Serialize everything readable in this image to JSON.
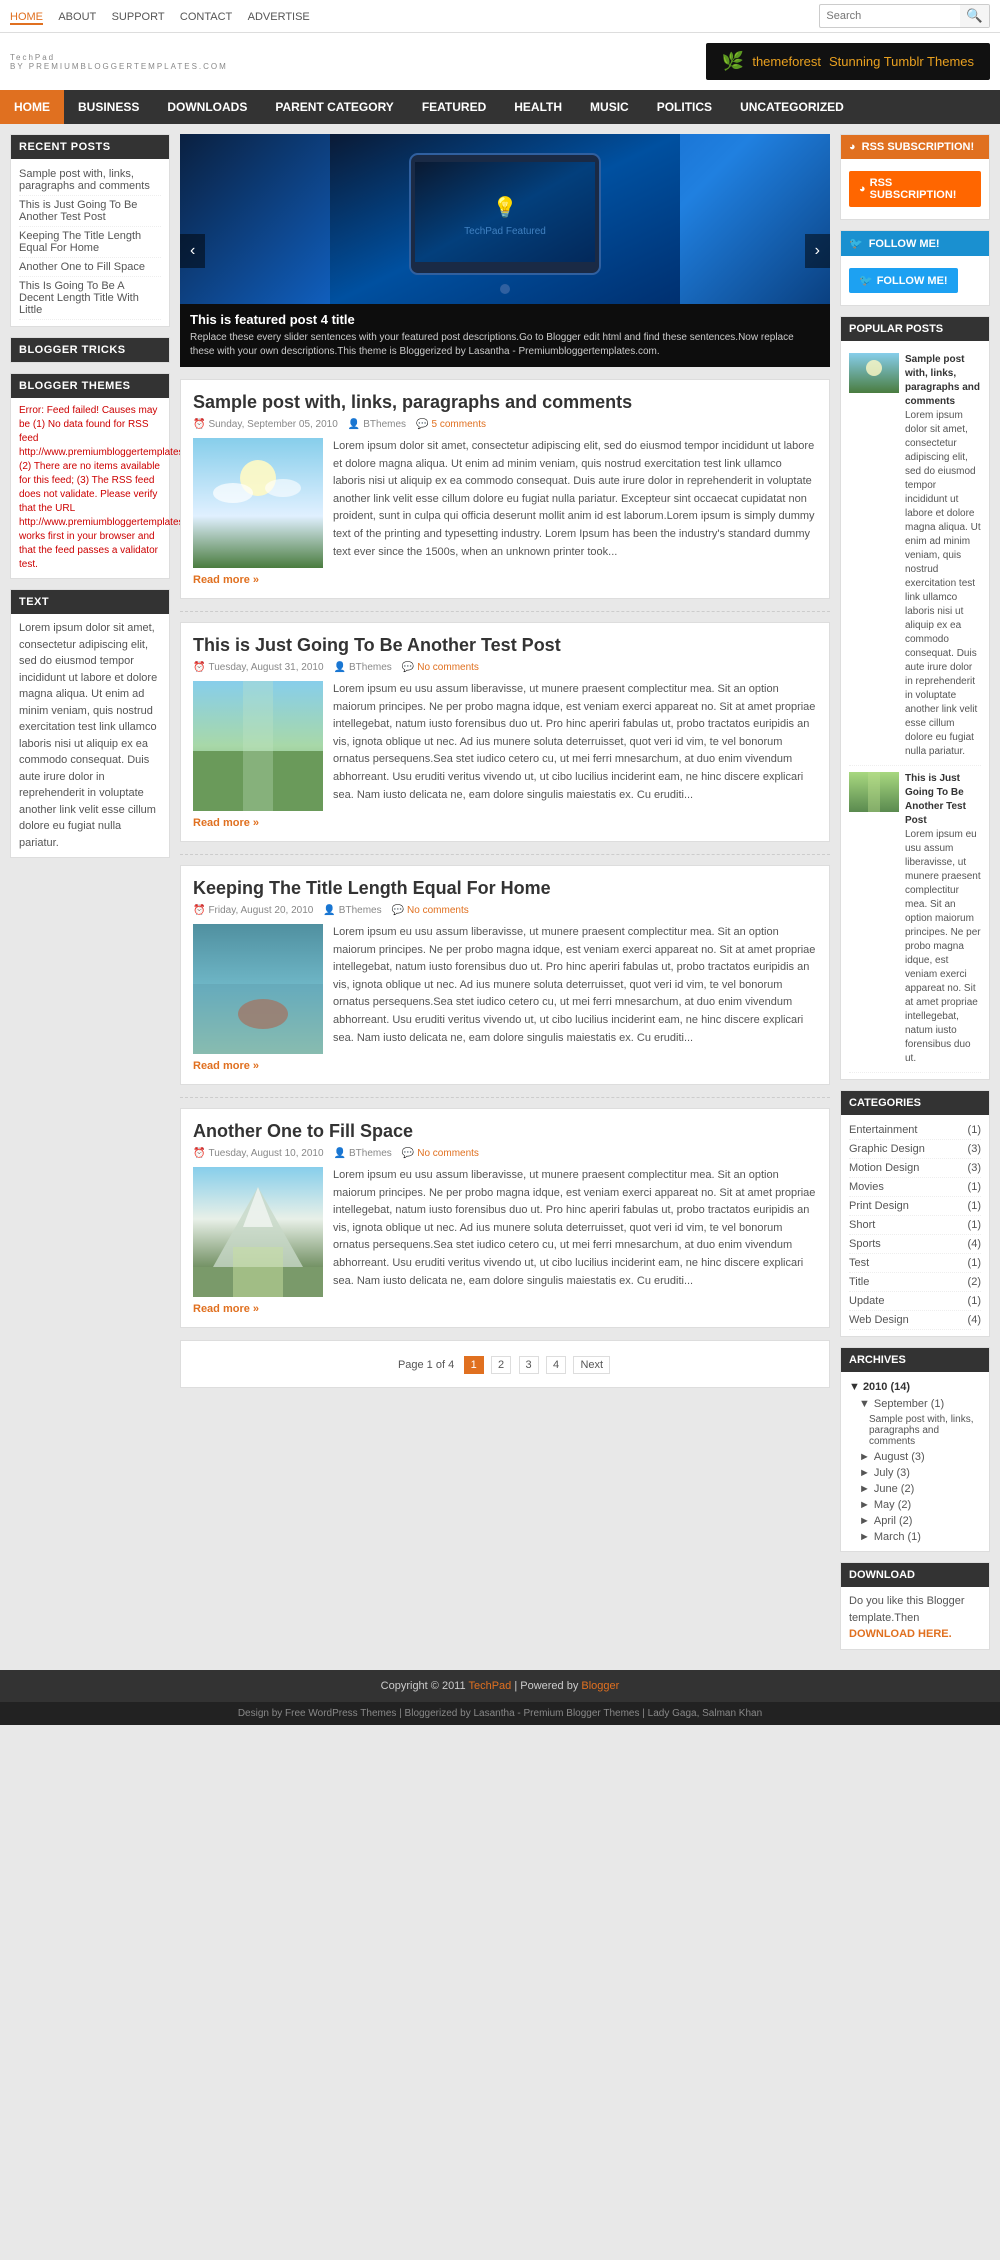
{
  "topnav": {
    "links": [
      {
        "label": "HOME",
        "active": true
      },
      {
        "label": "ABOUT",
        "active": false
      },
      {
        "label": "SUPPORT",
        "active": false
      },
      {
        "label": "CONTACT",
        "active": false
      },
      {
        "label": "ADVERTISE",
        "active": false
      }
    ],
    "search_placeholder": "Search"
  },
  "header": {
    "logo": "TechPad",
    "tagline": "BY PREMIUMBLOGGERTEMPLATES.COM",
    "banner_text": "Stunning Tumblr Themes",
    "banner_site": "themeforest"
  },
  "mainnav": {
    "links": [
      {
        "label": "HOME",
        "active": true
      },
      {
        "label": "BUSINESS",
        "active": false
      },
      {
        "label": "DOWNLOADS",
        "active": false
      },
      {
        "label": "PARENT CATEGORY",
        "active": false
      },
      {
        "label": "FEATURED",
        "active": false
      },
      {
        "label": "HEALTH",
        "active": false
      },
      {
        "label": "MUSIC",
        "active": false
      },
      {
        "label": "POLITICS",
        "active": false
      },
      {
        "label": "UNCATEGORIZED",
        "active": false
      }
    ]
  },
  "left_sidebar": {
    "recent_posts_title": "RECENT POSTS",
    "recent_posts": [
      {
        "title": "Sample post with, links, paragraphs and comments"
      },
      {
        "title": "This is Just Going To Be Another Test Post"
      },
      {
        "title": "Keeping The Title Length Equal For Home"
      },
      {
        "title": "Another One to Fill Space"
      },
      {
        "title": "This Is Going To Be A Decent Length Title With Little"
      }
    ],
    "blogger_tricks_title": "BLOGGER TRICKS",
    "blogger_themes_title": "BLOGGER THEMES",
    "blogger_themes_error": "Error: Feed failed! Causes may be (1) No data found for RSS feed http://www.premiumbloggertemplates.com/feed; (2) There are no items available for this feed; (3) The RSS feed does not validate.\n\nPlease verify that the URL http://www.premiumbloggertemplates.com/feed works first in your browser and that the feed passes a validator test.",
    "text_title": "TEXT",
    "text_content": "Lorem ipsum dolor sit amet, consectetur adipiscing elit, sed do eiusmod tempor incididunt ut labore et dolore magna aliqua. Ut enim ad minim veniam, quis nostrud exercitation test link ullamco laboris nisi ut aliquip ex ea commodo consequat. Duis aute irure dolor in reprehenderit in voluptate another link velit esse cillum dolore eu fugiat nulla pariatur."
  },
  "slider": {
    "featured_title": "This is featured post 4 title",
    "featured_desc": "Replace these every slider sentences with your featured post descriptions.Go to Blogger edit html and find these sentences.Now replace these with your own descriptions.This theme is Bloggerized by Lasantha - Premiumbloggertemplates.com."
  },
  "posts": [
    {
      "id": 1,
      "title": "Sample post with, links, paragraphs and comments",
      "date": "Sunday, September 05, 2010",
      "author": "BThemes",
      "comments": "5 comments",
      "thumb_class": "post-thumb-sky",
      "excerpt": "Lorem ipsum dolor sit amet, consectetur adipiscing elit, sed do eiusmod tempor incididunt ut labore et dolore magna aliqua. Ut enim ad minim veniam, quis nostrud exercitation test link ullamco laboris nisi ut aliquip ex ea commodo consequat. Duis aute irure dolor in reprehenderit in voluptate another link velit esse cillum dolore eu fugiat nulla pariatur. Excepteur sint occaecat cupidatat non proident, sunt in culpa qui officia deserunt mollit anim id est laborum.Lorem ipsum is simply dummy text of the printing and typesetting industry. Lorem Ipsum has been the industry's standard dummy text ever since the 1500s, when an unknown printer took...",
      "read_more": "Read more »"
    },
    {
      "id": 2,
      "title": "This is Just Going To Be Another Test Post",
      "date": "Tuesday, August 31, 2010",
      "author": "BThemes",
      "comments": "No comments",
      "thumb_class": "post-thumb-field",
      "excerpt": "Lorem ipsum eu usu assum liberavisse, ut munere praesent complectitur mea. Sit an option maiorum principes. Ne per probo magna idque, est veniam exerci appareat no. Sit at amet propriae intellegebat, natum iusto forensibus duo ut. Pro hinc aperiri fabulas ut, probo tractatos euripidis an vis, ignota oblique ut nec. Ad ius munere soluta deterruisset, quot veri id vim, te vel bonorum ornatus persequens.Sea stet iudico cetero cu, ut mei ferri mnesarchum, at duo enim vivendum abhorreant. Usu eruditi veritus vivendo ut, ut cibo lucilius inciderint eam, ne hinc discere explicari sea. Nam iusto delicata ne, eam dolore singulis maiestatis ex. Cu eruditi...",
      "read_more": "Read more »"
    },
    {
      "id": 3,
      "title": "Keeping The Title Length Equal For Home",
      "date": "Friday, August 20, 2010",
      "author": "BThemes",
      "comments": "No comments",
      "thumb_class": "post-thumb-water",
      "excerpt": "Lorem ipsum eu usu assum liberavisse, ut munere praesent complectitur mea. Sit an option maiorum principes. Ne per probo magna idque, est veniam exerci appareat no. Sit at amet propriae intellegebat, natum iusto forensibus duo ut. Pro hinc aperiri fabulas ut, probo tractatos euripidis an vis, ignota oblique ut nec. Ad ius munere soluta deterruisset, quot veri id vim, te vel bonorum ornatus persequens.Sea stet iudico cetero cu, ut mei ferri mnesarchum, at duo enim vivendum abhorreant. Usu eruditi veritus vivendo ut, ut cibo lucilius inciderint eam, ne hinc discere explicari sea. Nam iusto delicata ne, eam dolore singulis maiestatis ex. Cu eruditi...",
      "read_more": "Read more »"
    },
    {
      "id": 4,
      "title": "Another One to Fill Space",
      "date": "Tuesday, August 10, 2010",
      "author": "BThemes",
      "comments": "No comments",
      "thumb_class": "post-thumb-mountain",
      "excerpt": "Lorem ipsum eu usu assum liberavisse, ut munere praesent complectitur mea. Sit an option maiorum principes. Ne per probo magna idque, est veniam exerci appareat no. Sit at amet propriae intellegebat, natum iusto forensibus duo ut. Pro hinc aperiri fabulas ut, probo tractatos euripidis an vis, ignota oblique ut nec. Ad ius munere soluta deterruisset, quot veri id vim, te vel bonorum ornatus persequens.Sea stet iudico cetero cu, ut mei ferri mnesarchum, at duo enim vivendum abhorreant. Usu eruditi veritus vivendo ut, ut cibo lucilius inciderint eam, ne hinc discere explicari sea. Nam iusto delicata ne, eam dolore singulis maiestatis ex. Cu eruditi...",
      "read_more": "Read more »"
    }
  ],
  "pagination": {
    "page_label": "Page 1 of 4",
    "pages": [
      "1",
      "2",
      "3",
      "4"
    ],
    "next_label": "Next",
    "active": "1"
  },
  "right_sidebar": {
    "rss_title": "RSS SUBSCRIPTION!",
    "rss_label": "RSS SUBSCRIPTION!",
    "follow_title": "FOLLOW ME!",
    "follow_label": "FOLLOW ME!",
    "popular_posts_title": "POPULAR POSTS",
    "popular_posts": [
      {
        "title": "Sample post with, links, paragraphs and comments",
        "excerpt": "Lorem ipsum dolor sit amet, consectetur adipiscing elit, sed do eiusmod tempor incididunt ut labore et dolore magna aliqua. Ut enim ad minim veniam, quis nostrud exercitation test link ullamco laboris nisi ut aliquip ex ea commodo consequat. Duis aute irure dolor in reprehenderit in voluptate another link velit esse cillum dolore eu fugiat nulla pariatur.",
        "thumb_class": "post-thumb-sky"
      },
      {
        "title": "This is Just Going To Be Another Test Post",
        "excerpt": "Lorem ipsum eu usu assum liberavisse, ut munere praesent complectitur mea. Sit an option maiorum principes. Ne per probo magna idque, est veniam exerci appareat no. Sit at amet propriae intellegebat, natum iusto forensibus duo ut.",
        "thumb_class": "post-thumb-field"
      }
    ],
    "categories_title": "CATEGORIES",
    "categories": [
      {
        "label": "Entertainment",
        "count": 1
      },
      {
        "label": "Graphic Design",
        "count": 3
      },
      {
        "label": "Motion Design",
        "count": 3
      },
      {
        "label": "Movies",
        "count": 1
      },
      {
        "label": "Print Design",
        "count": 1
      },
      {
        "label": "Short",
        "count": 1
      },
      {
        "label": "Sports",
        "count": 4
      },
      {
        "label": "Test",
        "count": 1
      },
      {
        "label": "Title",
        "count": 2
      },
      {
        "label": "Update",
        "count": 1
      },
      {
        "label": "Web Design",
        "count": 4
      }
    ],
    "archives_title": "ARCHIVES",
    "archives": [
      {
        "year": "2010",
        "count": 14,
        "months": [
          {
            "month": "September",
            "count": 1,
            "posts": [
              "Sample post with, links, paragraphs and comments"
            ]
          },
          {
            "month": "August",
            "count": 3
          },
          {
            "month": "July",
            "count": 3
          },
          {
            "month": "June",
            "count": 2
          },
          {
            "month": "May",
            "count": 2
          },
          {
            "month": "April",
            "count": 2
          },
          {
            "month": "March",
            "count": 1
          }
        ]
      }
    ],
    "download_title": "DOWNLOAD",
    "download_text": "Do you like this Blogger template.Then DOWNLOAD HERE."
  },
  "footer": {
    "copyright": "Copyright © 2011 TechPad | Powered by Blogger",
    "techpad_link": "TechPad",
    "blogger_link": "Blogger",
    "bottom_text": "Design by Free WordPress Themes | Bloggerized by Lasantha - Premium Blogger Themes | Lady Gaga, Salman Khan"
  }
}
